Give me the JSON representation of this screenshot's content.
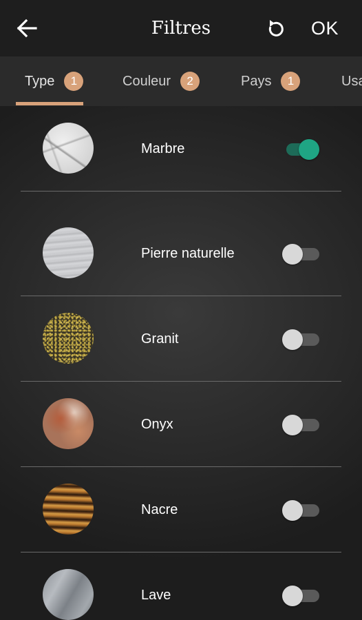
{
  "header": {
    "title": "Filtres",
    "ok_label": "OK",
    "back_icon": "arrow-left-icon",
    "reset_icon": "reset-icon"
  },
  "tabs": [
    {
      "label": "Type",
      "badge": "1",
      "active": true
    },
    {
      "label": "Couleur",
      "badge": "2",
      "active": false
    },
    {
      "label": "Pays",
      "badge": "1",
      "active": false
    },
    {
      "label": "Usa",
      "badge": "",
      "active": false
    }
  ],
  "items": [
    {
      "label": "Marbre",
      "enabled": true
    },
    {
      "label": "Pierre naturelle",
      "enabled": false
    },
    {
      "label": "Granit",
      "enabled": false
    },
    {
      "label": "Onyx",
      "enabled": false
    },
    {
      "label": "Nacre",
      "enabled": false
    },
    {
      "label": "Lave",
      "enabled": false
    }
  ],
  "colors": {
    "accent": "#d8a27a",
    "toggle_on": "#1fa584",
    "toggle_off": "#d8d8d8",
    "background": "#222222"
  }
}
